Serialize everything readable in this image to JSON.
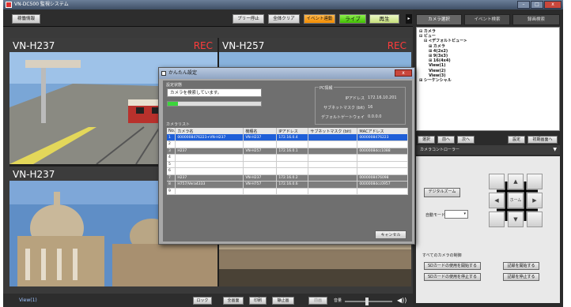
{
  "window": {
    "title": "VN-DC500 監視システム",
    "controls": [
      "–",
      "□",
      "x"
    ]
  },
  "toolbar": {
    "setup": "稼働情報",
    "print_stop": "プリー停止",
    "clear_all": "全体クリア",
    "event": "イベント連動",
    "live": "ライブ",
    "playback": "再生",
    "arrow": "▸"
  },
  "cameras": [
    {
      "name": "VN-H237",
      "rec": "REC"
    },
    {
      "name": "VN-H257",
      "rec": "REC"
    },
    {
      "name": "VN-H237",
      "rec": ""
    },
    {
      "name": "",
      "rec": ""
    }
  ],
  "statusbar": {
    "view": "View(1)",
    "lock": "ロック",
    "fullscreen": "全画面",
    "print": "印刷",
    "still": "静止画",
    "prev": "前画",
    "volume": "音量",
    "speaker_icon": "◀))"
  },
  "right_panel": {
    "tabs": [
      "カメラ選択",
      "イベント検索",
      "録画検索"
    ],
    "tree": [
      {
        "text": "⊟ カメラ",
        "indent": 0,
        "bold": true
      },
      {
        "text": "⊟ ビュー",
        "indent": 0,
        "bold": true
      },
      {
        "text": "⊟ <デフォルトビュー>",
        "indent": 1,
        "bold": true
      },
      {
        "text": "⊞ カメラ",
        "indent": 2,
        "bold": true
      },
      {
        "text": "⊞ 4(2x2)",
        "indent": 2,
        "bold": true
      },
      {
        "text": "⊞ 9(3x3)",
        "indent": 2,
        "bold": true
      },
      {
        "text": "⊞ 16(4x4)",
        "indent": 2,
        "bold": true
      },
      {
        "text": "View(1)",
        "indent": 2,
        "bold": true
      },
      {
        "text": "View(2)",
        "indent": 2,
        "bold": true
      },
      {
        "text": "View(3)",
        "indent": 2,
        "bold": true
      },
      {
        "text": "⊞ シーケンシャル",
        "indent": 0,
        "bold": true
      }
    ],
    "buttons": {
      "select": "選択",
      "prev": "前へ",
      "next": "次へ",
      "settings": "設定",
      "initial_view": "初期画面へ"
    },
    "camera_controller": "カメラコントローラー",
    "digital_zoom": "デジタルズーム",
    "auto_mode_label": "自動モード",
    "auto_mode_value": "",
    "ptz": {
      "up": "▲",
      "down": "▼",
      "left": "◀",
      "right": "▶",
      "home": "ホーム"
    },
    "all_cameras_label": "すべてのカメラの制御",
    "sd_start": "SDカードの使用を開始する",
    "sd_stop": "SDカードの使用を停止する",
    "rec_start": "記録を開始する",
    "rec_stop": "記録を停止する"
  },
  "dialog": {
    "title": "かんたん設定",
    "close": "x",
    "setup_label": "設定状態",
    "status_text": "カメラを検索しています。",
    "progress": 0.11,
    "pc_label": "PC情報",
    "pc_info": [
      {
        "key": "IPアドレス",
        "value": "172.16.10.201"
      },
      {
        "key": "サブネットマスク (bit)",
        "value": "16"
      },
      {
        "key": "デフォルトゲートウェイ",
        "value": "0.0.0.0"
      }
    ],
    "camera_list_label": "カメラリスト",
    "columns": [
      "No.",
      "カメラ名",
      "機種名",
      "IPアドレス",
      "サブネットマスク (bit)",
      "MACアドレス"
    ],
    "rows": [
      {
        "no": "1",
        "name": "0000008476223+VN-H237",
        "model": "VN-H237",
        "ip": "172.16.0.4",
        "mask": "",
        "mac": "0000008476223",
        "style": "sel"
      },
      {
        "no": "2",
        "name": "",
        "model": "",
        "ip": "",
        "mask": "",
        "mac": "",
        "style": ""
      },
      {
        "no": "3",
        "name": "H237",
        "model": "VN-H257",
        "ip": "172.16.0.1",
        "mask": "",
        "mac": "0000008dcc1088",
        "style": "dark"
      },
      {
        "no": "4",
        "name": "",
        "model": "",
        "ip": "",
        "mask": "",
        "mac": "",
        "style": ""
      },
      {
        "no": "5",
        "name": "",
        "model": "",
        "ip": "",
        "mask": "",
        "mac": "",
        "style": ""
      },
      {
        "no": "6",
        "name": "",
        "model": "",
        "ip": "",
        "mask": "",
        "mac": "",
        "style": ""
      },
      {
        "no": "7",
        "name": "H237",
        "model": "VN-H237",
        "ip": "172.16.0.2",
        "mask": "",
        "mac": "0000008476098",
        "style": "dark"
      },
      {
        "no": "8",
        "name": "H757/Vera4333",
        "model": "VN-H757",
        "ip": "172.16.0.6",
        "mask": "",
        "mac": "0000008dcc0957",
        "style": "dark"
      },
      {
        "no": "9",
        "name": "",
        "model": "",
        "ip": "",
        "mask": "",
        "mac": "",
        "style": ""
      }
    ],
    "cancel": "キャンセル"
  }
}
